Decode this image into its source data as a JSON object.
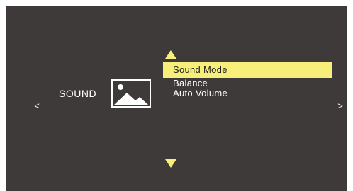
{
  "colors": {
    "background": "#3e3a39",
    "highlight": "#f7ef7a",
    "arrow": "#f7ef7a",
    "text": "#ffffff"
  },
  "navigation": {
    "left_glyph": "<",
    "right_glyph": ">"
  },
  "category": {
    "label": "SOUND",
    "icon": "picture-icon"
  },
  "menu": {
    "items": [
      {
        "label": "Sound Mode",
        "selected": true
      },
      {
        "label": "Balance",
        "selected": false
      },
      {
        "label": "Auto Volume",
        "selected": false
      }
    ]
  },
  "scroll": {
    "up_icon": "triangle-up-icon",
    "down_icon": "triangle-down-icon"
  }
}
